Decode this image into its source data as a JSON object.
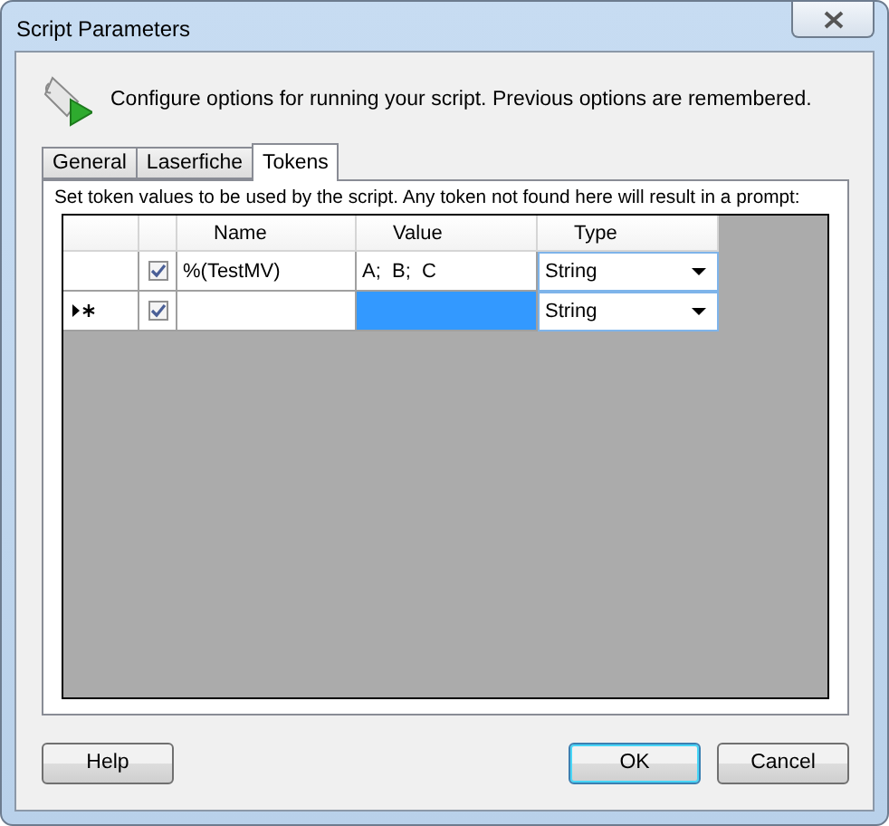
{
  "window": {
    "title": "Script Parameters"
  },
  "description": "Configure options for running your script. Previous options are remembered.",
  "tabs": [
    {
      "label": "General",
      "selected": false
    },
    {
      "label": "Laserfiche",
      "selected": false
    },
    {
      "label": "Tokens",
      "selected": true
    }
  ],
  "tokens": {
    "instruction": "Set token values to be used by the script. Any token not found here will result in a prompt:",
    "columns": [
      "Name",
      "Value",
      "Type"
    ],
    "rows": [
      {
        "checked": true,
        "name": "%(TestMV)",
        "value": "A;  B;  C",
        "type": "String",
        "new_row": false,
        "value_selected": false
      },
      {
        "checked": true,
        "name": "",
        "value": "",
        "type": "String",
        "new_row": true,
        "value_selected": true
      }
    ]
  },
  "buttons": [
    {
      "label": "Help",
      "default": false
    },
    {
      "label": "OK",
      "default": true
    },
    {
      "label": "Cancel",
      "default": false
    }
  ]
}
